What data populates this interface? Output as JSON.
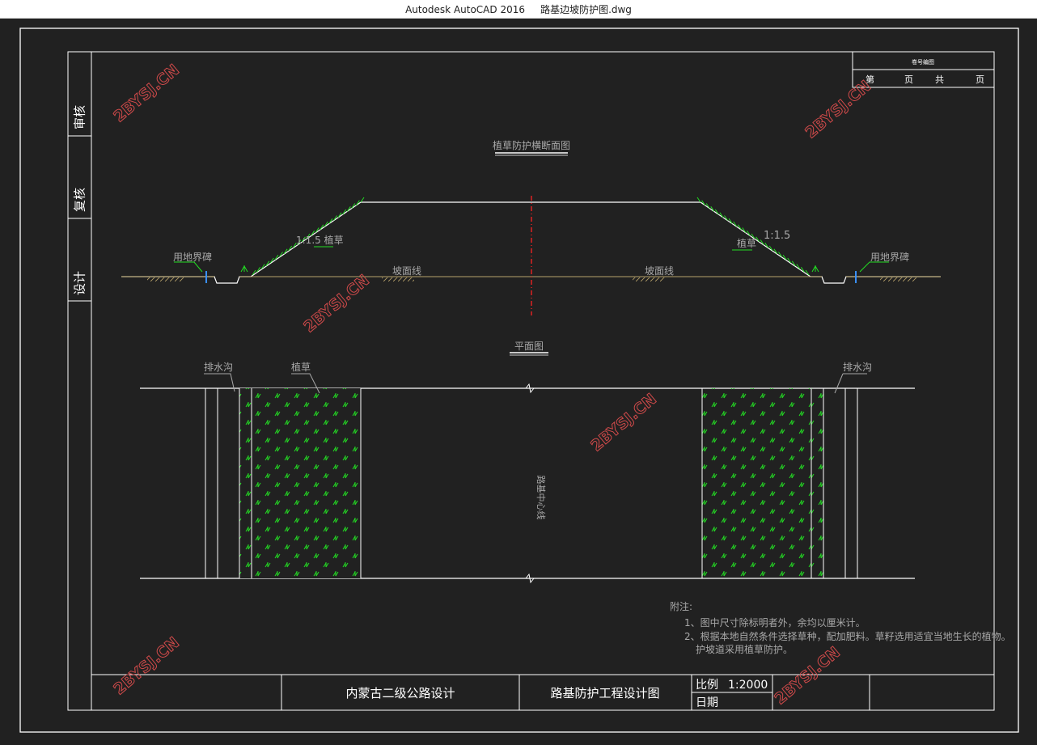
{
  "window": {
    "app_name": "Autodesk AutoCAD 2016",
    "file_name": "路基边坡防护图.dwg"
  },
  "drawing": {
    "section_title": "植草防护横断面图",
    "plan_title": "平面图",
    "slope_left_label": "1:1.5 植草",
    "slope_right_ratio": "1:1.5",
    "grass_label_right": "植草",
    "boundary_marker_left": "用地界碑",
    "boundary_marker_right": "用地界碑",
    "ground_line_left": "坡面线",
    "ground_line_right": "坡面线",
    "ditch_label_left": "排水沟",
    "grass_label_plan": "植草",
    "ditch_label_right": "排水沟",
    "centerline_label": "路基中心线",
    "notes_title": "附注:",
    "notes": [
      "1、图中尺寸除标明者外，余均以厘米计。",
      "2、根据本地自然条件选择草种，配加肥料。草籽选用适宜当地生长的植物。",
      "护坡道采用植草防护。"
    ],
    "watermark": "2BYSJ.CN"
  },
  "side_bar": {
    "review_label": "审核",
    "recheck_label": "复核",
    "design_label": "设计"
  },
  "top_right_box": {
    "header": "卷号编图",
    "page_label": "第",
    "page_unit": "页",
    "total_label": "共",
    "total_unit": "页"
  },
  "title_block": {
    "project": "内蒙古二级公路设计",
    "drawing_name": "路基防护工程设计图",
    "scale_label": "比例",
    "scale_value": "1:2000",
    "date_label": "日期"
  },
  "colors": {
    "background": "#212121",
    "line": "#ffffff",
    "grass": "#22dd22",
    "centerline": "#dd2222",
    "ground": "#b8a36a",
    "label": "#a8a8a8",
    "marker": "#3a8fff",
    "watermark": "#d04a4a"
  }
}
